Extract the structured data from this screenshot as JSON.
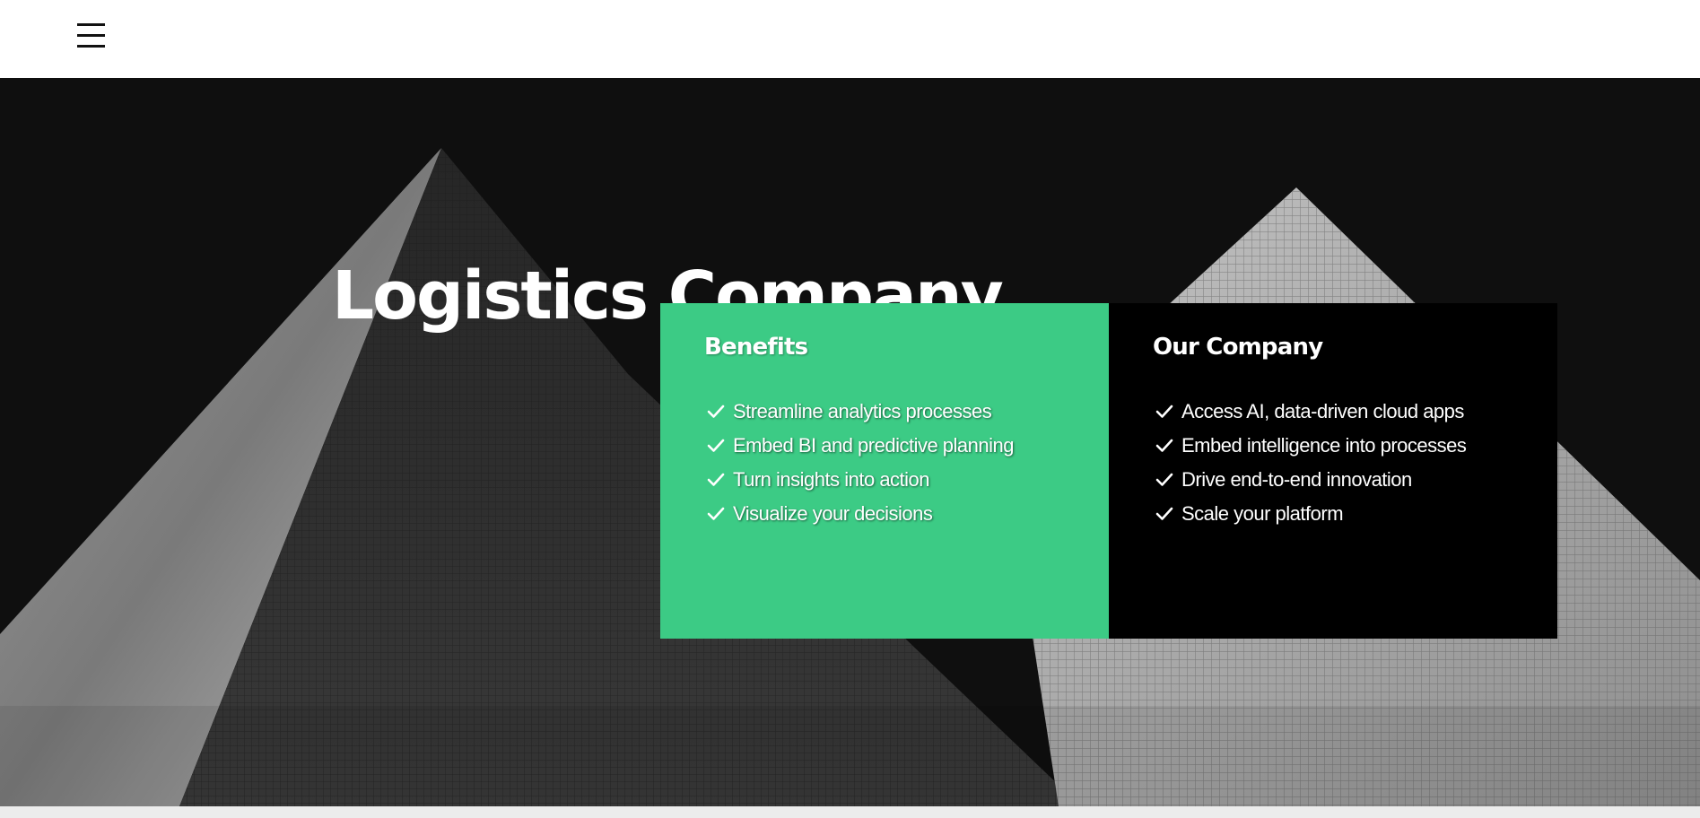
{
  "header": {
    "menu_icon": "hamburger-menu-icon"
  },
  "hero": {
    "title": "Logistics Company"
  },
  "panels": [
    {
      "title": "Benefits",
      "color": "#3ccb85",
      "items": [
        "Streamline analytics processes",
        "Embed BI and predictive planning",
        "Turn insights into action",
        "Visualize your decisions"
      ]
    },
    {
      "title": "Our Company",
      "color": "#000000",
      "items": [
        "Access AI, data-driven cloud apps",
        "Embed intelligence into processes",
        "Drive end-to-end innovation",
        "Scale your platform"
      ]
    }
  ],
  "icons": {
    "check": "check-icon"
  }
}
